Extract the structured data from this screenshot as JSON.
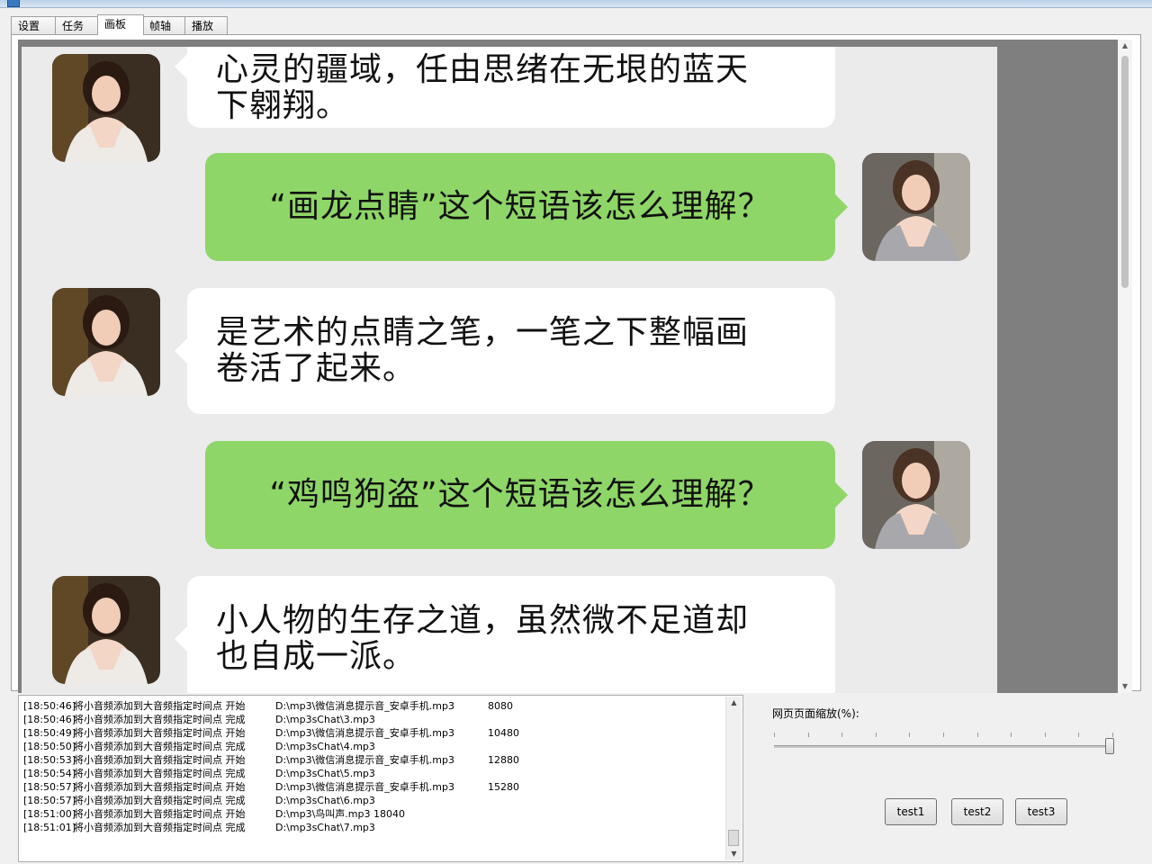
{
  "tabs": [
    "设置",
    "任务",
    "画板",
    "帧轴",
    "播放"
  ],
  "active_tab": "画板",
  "chat": {
    "messages": [
      {
        "side": "left",
        "lines": [
          "心灵的疆域，任由思绪在无垠的蓝天",
          "下翱翔。"
        ]
      },
      {
        "side": "right",
        "lines": [
          "“画龙点睛”这个短语该怎么理解？"
        ]
      },
      {
        "side": "left",
        "lines": [
          "是艺术的点睛之笔，一笔之下整幅画",
          "卷活了起来。"
        ]
      },
      {
        "side": "right",
        "lines": [
          "“鸡鸣狗盗”这个短语该怎么理解？"
        ]
      },
      {
        "side": "left",
        "lines": [
          "小人物的生存之道，虽然微不足道却",
          "也自成一派。"
        ]
      }
    ],
    "colors": {
      "background": "#ebebeb",
      "bubble_white": "#ffffff",
      "bubble_green": "#8ed667"
    }
  },
  "log": [
    {
      "time": "[18:50:46]",
      "msg": "将小音频添加到大音频指定时间点 开始",
      "path": "D:\\mp3\\微信消息提示音_安卓手机.mp3",
      "extra": "8080"
    },
    {
      "time": "[18:50:46]",
      "msg": "将小音频添加到大音频指定时间点 完成",
      "path": "D:\\mp3sChat\\3.mp3",
      "extra": ""
    },
    {
      "time": "[18:50:49]",
      "msg": "将小音频添加到大音频指定时间点 开始",
      "path": "D:\\mp3\\微信消息提示音_安卓手机.mp3",
      "extra": "10480"
    },
    {
      "time": "[18:50:50]",
      "msg": "将小音频添加到大音频指定时间点 完成",
      "path": "D:\\mp3sChat\\4.mp3",
      "extra": ""
    },
    {
      "time": "[18:50:53]",
      "msg": "将小音频添加到大音频指定时间点 开始",
      "path": "D:\\mp3\\微信消息提示音_安卓手机.mp3",
      "extra": "12880"
    },
    {
      "time": "[18:50:54]",
      "msg": "将小音频添加到大音频指定时间点 完成",
      "path": "D:\\mp3sChat\\5.mp3",
      "extra": ""
    },
    {
      "time": "[18:50:57]",
      "msg": "将小音频添加到大音频指定时间点 开始",
      "path": "D:\\mp3\\微信消息提示音_安卓手机.mp3",
      "extra": "15280"
    },
    {
      "time": "[18:50:57]",
      "msg": "将小音频添加到大音频指定时间点 完成",
      "path": "D:\\mp3sChat\\6.mp3",
      "extra": ""
    },
    {
      "time": "[18:51:00]",
      "msg": "将小音频添加到大音频指定时间点 开始",
      "path": "D:\\mp3\\鸟叫声.mp3 18040",
      "extra": ""
    },
    {
      "time": "[18:51:01]",
      "msg": "将小音频添加到大音频指定时间点 完成",
      "path": "D:\\mp3sChat\\7.mp3",
      "extra": ""
    }
  ],
  "zoom": {
    "label": "网页页面缩放(%):",
    "level_fraction": 1.0
  },
  "buttons": {
    "test1": "test1",
    "test2": "test2",
    "test3": "test3"
  },
  "icons": {
    "scroll_up": "scroll-up-arrow-icon",
    "scroll_down": "scroll-down-arrow-icon"
  }
}
